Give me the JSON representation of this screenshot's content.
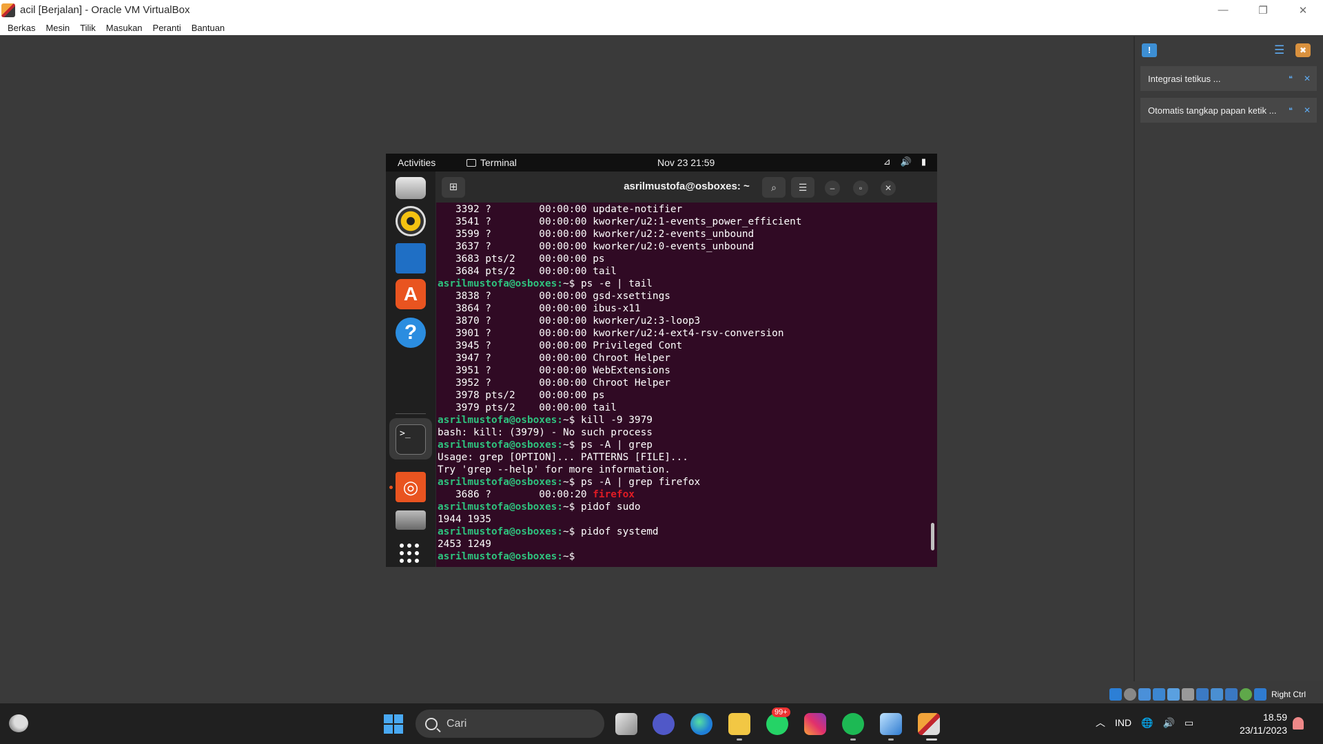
{
  "window": {
    "title": "acil [Berjalan] - Oracle VM VirtualBox",
    "controls": [
      "—",
      "❐",
      "✕"
    ]
  },
  "vbox_menu": [
    "Berkas",
    "Mesin",
    "Tilik",
    "Masukan",
    "Peranti",
    "Bantuan"
  ],
  "notifications": [
    {
      "text": "Integrasi tetikus ..."
    },
    {
      "text": "Otomatis tangkap papan ketik ..."
    }
  ],
  "vbox_status": {
    "host_key": "Right Ctrl"
  },
  "gnome": {
    "activities": "Activities",
    "app": "Terminal",
    "clock": "Nov 23  21:59"
  },
  "terminal": {
    "title": "asrilmustofa@osboxes: ~",
    "lines": [
      {
        "t": "   3392 ?        00:00:00 update-notifier"
      },
      {
        "t": "   3541 ?        00:00:00 kworker/u2:1-events_power_efficient"
      },
      {
        "t": "   3599 ?        00:00:00 kworker/u2:2-events_unbound"
      },
      {
        "t": "   3637 ?        00:00:00 kworker/u2:0-events_unbound"
      },
      {
        "t": "   3683 pts/2    00:00:00 ps"
      },
      {
        "t": "   3684 pts/2    00:00:00 tail"
      },
      {
        "p": "asrilmustofa@osboxes:",
        "t": "~$ ps -e | tail"
      },
      {
        "t": "   3838 ?        00:00:00 gsd-xsettings"
      },
      {
        "t": "   3864 ?        00:00:00 ibus-x11"
      },
      {
        "t": "   3870 ?        00:00:00 kworker/u2:3-loop3"
      },
      {
        "t": "   3901 ?        00:00:00 kworker/u2:4-ext4-rsv-conversion"
      },
      {
        "t": "   3945 ?        00:00:00 Privileged Cont"
      },
      {
        "t": "   3947 ?        00:00:00 Chroot Helper"
      },
      {
        "t": "   3951 ?        00:00:00 WebExtensions"
      },
      {
        "t": "   3952 ?        00:00:00 Chroot Helper"
      },
      {
        "t": "   3978 pts/2    00:00:00 ps"
      },
      {
        "t": "   3979 pts/2    00:00:00 tail"
      },
      {
        "p": "asrilmustofa@osboxes:",
        "t": "~$ kill -9 3979"
      },
      {
        "t": "bash: kill: (3979) - No such process"
      },
      {
        "p": "asrilmustofa@osboxes:",
        "t": "~$ ps -A | grep"
      },
      {
        "t": "Usage: grep [OPTION]... PATTERNS [FILE]..."
      },
      {
        "t": "Try 'grep --help' for more information."
      },
      {
        "p": "asrilmustofa@osboxes:",
        "t": "~$ ps -A | grep firefox"
      },
      {
        "t": "   3686 ?        00:00:20 ",
        "r": "firefox"
      },
      {
        "p": "asrilmustofa@osboxes:",
        "t": "~$ pidof sudo"
      },
      {
        "t": "1944 1935"
      },
      {
        "p": "asrilmustofa@osboxes:",
        "t": "~$ pidof systemd"
      },
      {
        "t": "2453 1249"
      },
      {
        "p": "asrilmustofa@osboxes:",
        "t": "~$ "
      }
    ]
  },
  "taskbar": {
    "search_placeholder": "Cari",
    "whatsapp_badge": "99+",
    "language": "IND",
    "time": "18.59",
    "date": "23/11/2023"
  },
  "colors": {
    "terminal_bg": "#300a24",
    "prompt": "#2ec27e",
    "match": "#e01b24",
    "ubuntu_accent": "#e95420"
  }
}
